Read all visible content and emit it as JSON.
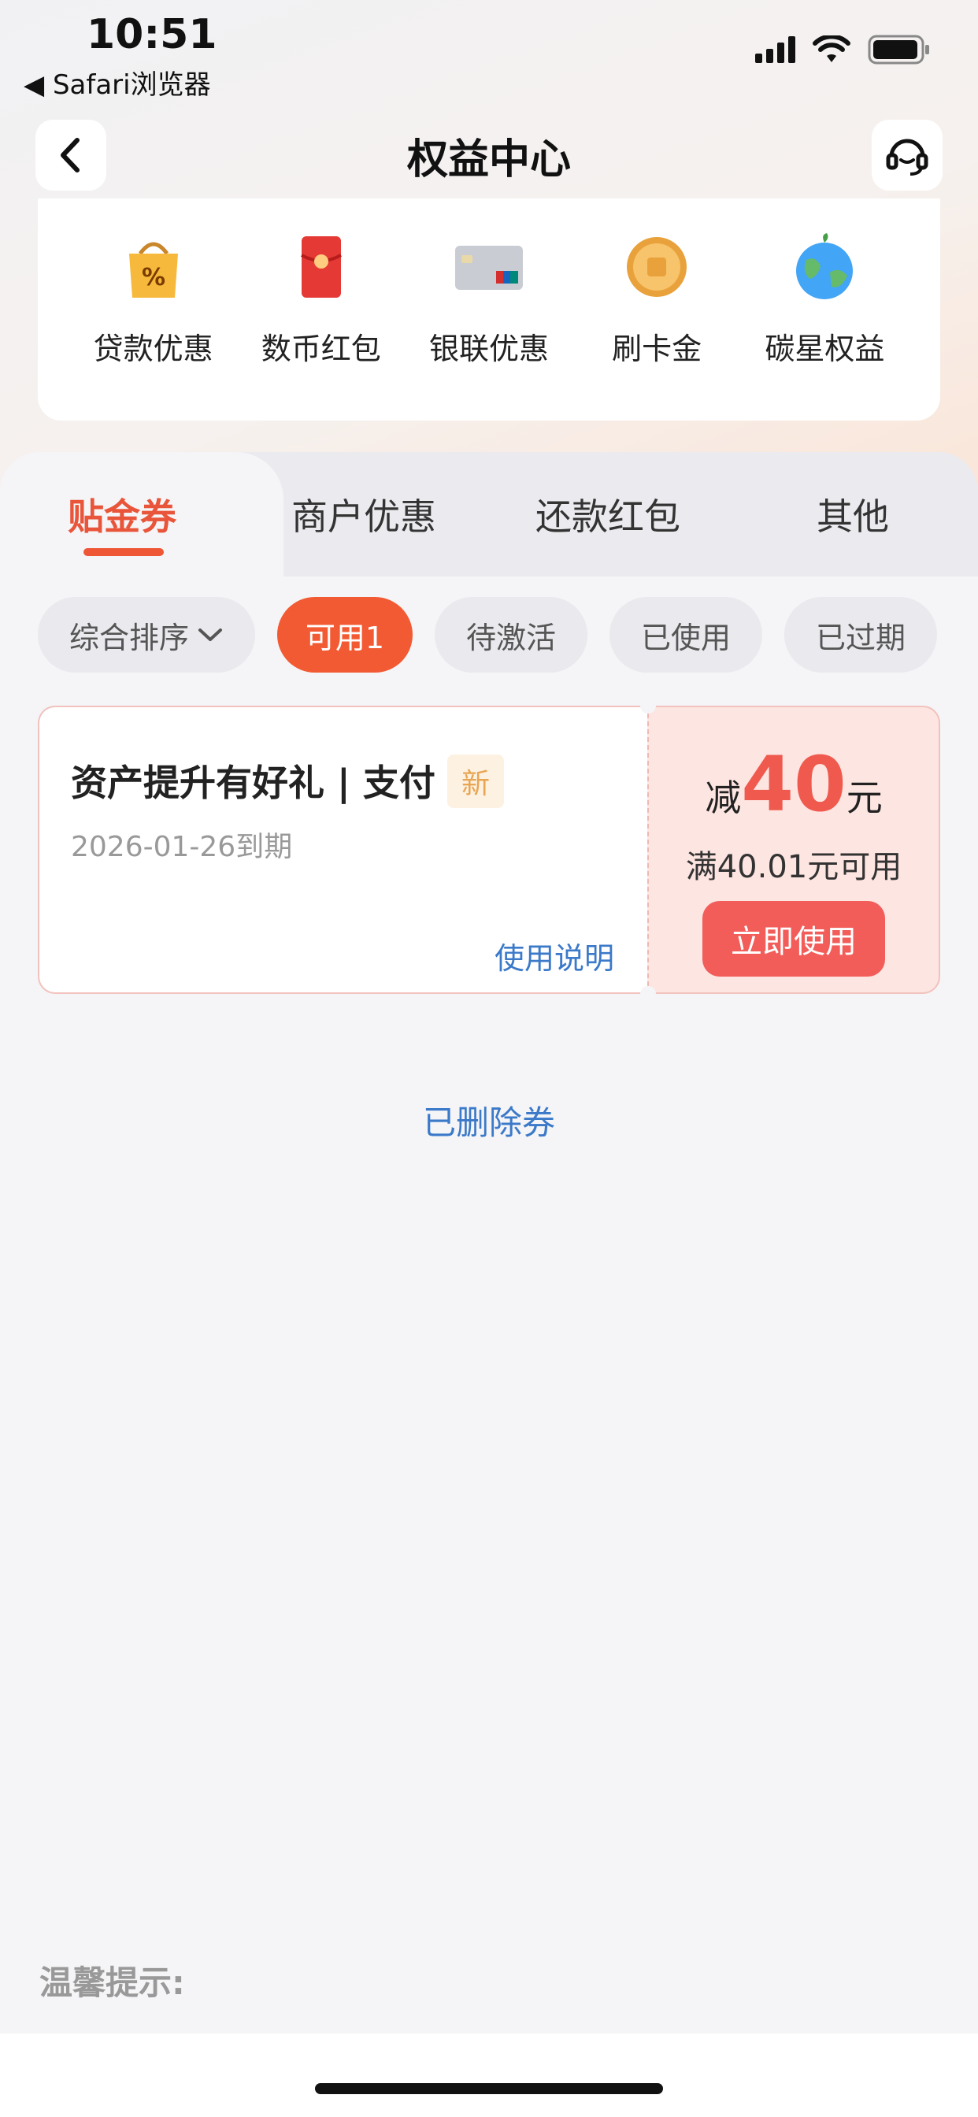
{
  "status_bar": {
    "time": "10:51",
    "back_app": "◀ Safari浏览器"
  },
  "nav": {
    "title": "权益中心",
    "back_icon": "chevron-left-icon",
    "service_icon": "headset-icon"
  },
  "categories": [
    {
      "label": "贷款优惠",
      "icon": "loan-bag-icon"
    },
    {
      "label": "数币红包",
      "icon": "red-envelope-icon"
    },
    {
      "label": "银联优惠",
      "icon": "unionpay-card-icon"
    },
    {
      "label": "刷卡金",
      "icon": "gold-coin-icon"
    },
    {
      "label": "碳星权益",
      "icon": "earth-icon"
    }
  ],
  "tabs": [
    {
      "label": "贴金券",
      "active": true
    },
    {
      "label": "商户优惠",
      "active": false
    },
    {
      "label": "还款红包",
      "active": false
    },
    {
      "label": "其他",
      "active": false
    }
  ],
  "filters": [
    {
      "label": "综合排序",
      "active": false
    },
    {
      "label": "可用1",
      "active": true
    },
    {
      "label": "待激活",
      "active": false
    },
    {
      "label": "已使用",
      "active": false
    },
    {
      "label": "已过期",
      "active": false
    }
  ],
  "coupon": {
    "title": "资产提升有好礼 | 支付",
    "badge": "新",
    "expire": "2026-01-26到期",
    "help": "使用说明",
    "amount_prefix": "减",
    "amount": "40",
    "amount_suffix": "元",
    "condition": "满40.01元可用",
    "action": "立即使用"
  },
  "deleted_link": "已删除券",
  "tips_label": "温馨提示:",
  "colors": {
    "accent": "#f25a33",
    "coupon_red": "#f05a4e",
    "link_blue": "#3b79c9"
  }
}
